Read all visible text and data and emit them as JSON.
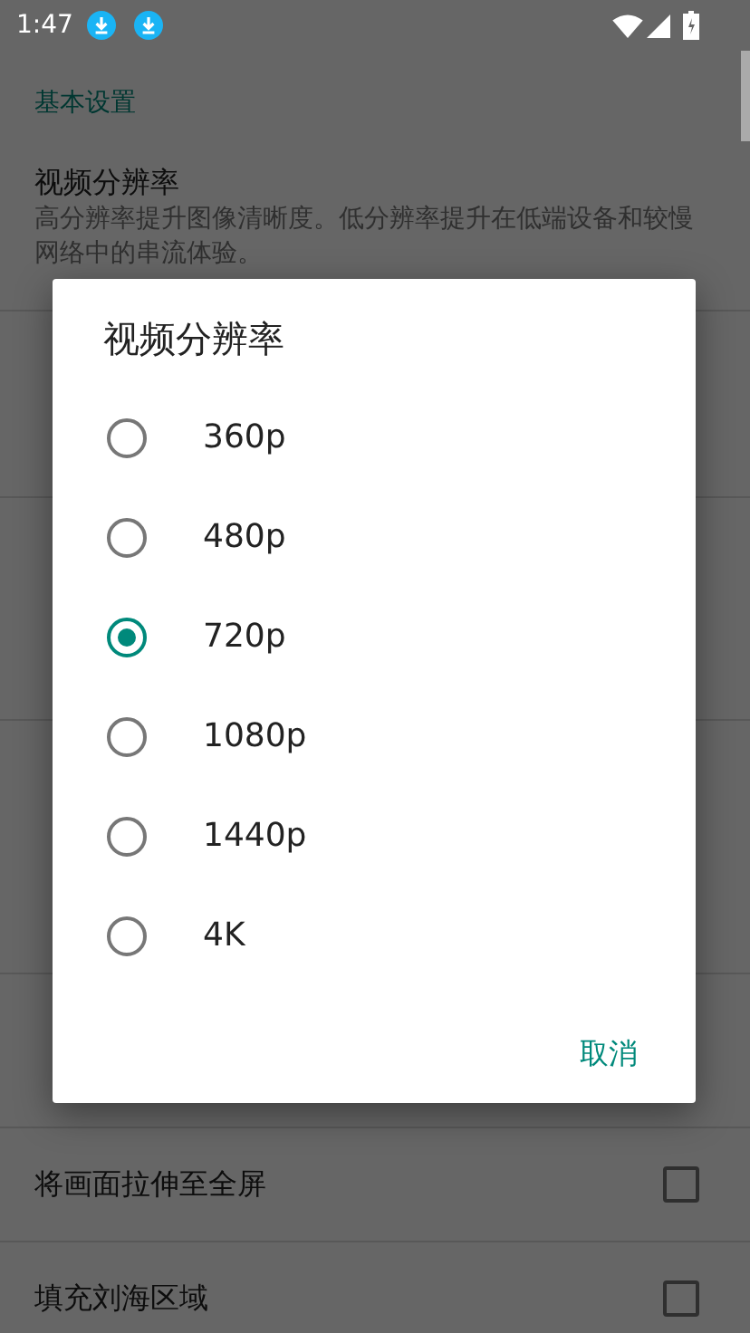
{
  "status_bar": {
    "time": "1:47"
  },
  "category": "基本设置",
  "setting": {
    "title": "视频分辨率",
    "summary": "高分辨率提升图像清晰度。低分辨率提升在低端设备和较慢网络中的串流体验。"
  },
  "check_rows": [
    {
      "label": "将画面拉伸至全屏",
      "checked": false
    },
    {
      "label": "填充刘海区域",
      "checked": false
    }
  ],
  "dialog": {
    "title": "视频分辨率",
    "options": [
      {
        "label": "360p",
        "selected": false
      },
      {
        "label": "480p",
        "selected": false
      },
      {
        "label": "720p",
        "selected": true
      },
      {
        "label": "1080p",
        "selected": false
      },
      {
        "label": "1440p",
        "selected": false
      },
      {
        "label": "4K",
        "selected": false
      }
    ],
    "cancel": "取消"
  }
}
